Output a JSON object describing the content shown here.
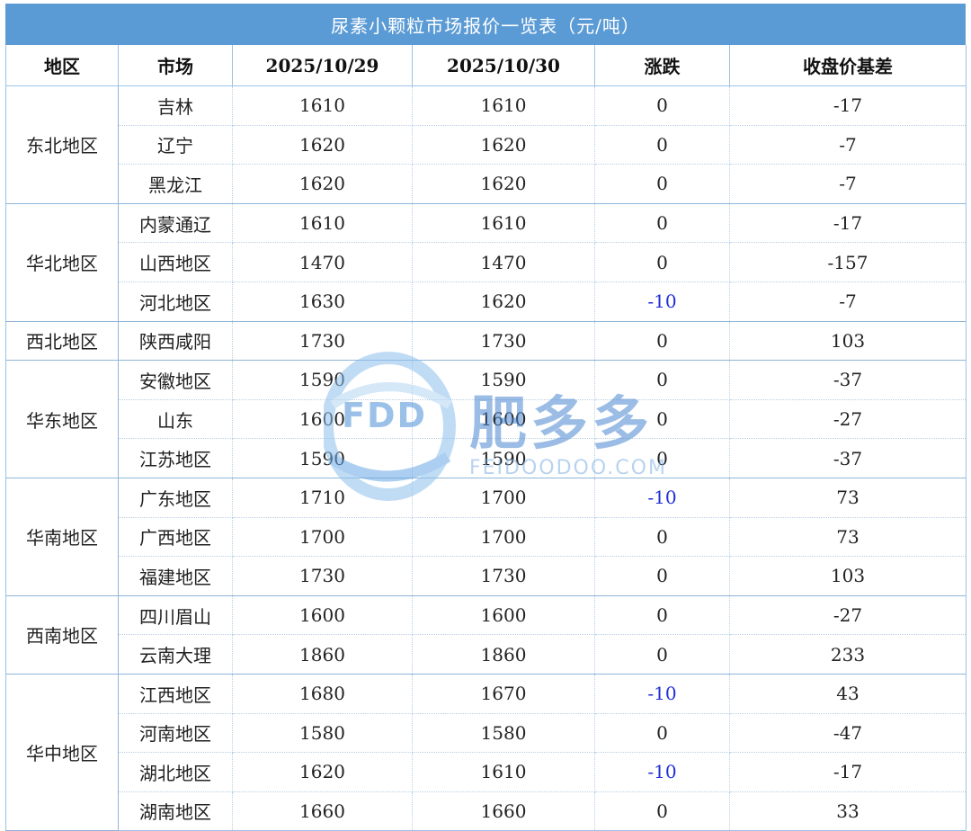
{
  "title": "尿素小颗粒市场报价一览表（元/吨）",
  "headers": [
    "地区",
    "市场",
    "2025/10/29",
    "2025/10/30",
    "涨跌",
    "收盘价基差"
  ],
  "groups": [
    {
      "region": "东北地区",
      "rows": [
        {
          "market": "吉林",
          "d1": "1610",
          "d2": "1610",
          "change": "0",
          "basis": "-17"
        },
        {
          "market": "辽宁",
          "d1": "1620",
          "d2": "1620",
          "change": "0",
          "basis": "-7"
        },
        {
          "market": "黑龙江",
          "d1": "1620",
          "d2": "1620",
          "change": "0",
          "basis": "-7"
        }
      ]
    },
    {
      "region": "华北地区",
      "rows": [
        {
          "market": "内蒙通辽",
          "d1": "1610",
          "d2": "1610",
          "change": "0",
          "basis": "-17"
        },
        {
          "market": "山西地区",
          "d1": "1470",
          "d2": "1470",
          "change": "0",
          "basis": "-157"
        },
        {
          "market": "河北地区",
          "d1": "1630",
          "d2": "1620",
          "change": "-10",
          "basis": "-7"
        }
      ]
    },
    {
      "region": "西北地区",
      "rows": [
        {
          "market": "陕西咸阳",
          "d1": "1730",
          "d2": "1730",
          "change": "0",
          "basis": "103"
        }
      ]
    },
    {
      "region": "华东地区",
      "rows": [
        {
          "market": "安徽地区",
          "d1": "1590",
          "d2": "1590",
          "change": "0",
          "basis": "-37"
        },
        {
          "market": "山东",
          "d1": "1600",
          "d2": "1600",
          "change": "0",
          "basis": "-27"
        },
        {
          "market": "江苏地区",
          "d1": "1590",
          "d2": "1590",
          "change": "0",
          "basis": "-37"
        }
      ]
    },
    {
      "region": "华南地区",
      "rows": [
        {
          "market": "广东地区",
          "d1": "1710",
          "d2": "1700",
          "change": "-10",
          "basis": "73"
        },
        {
          "market": "广西地区",
          "d1": "1700",
          "d2": "1700",
          "change": "0",
          "basis": "73"
        },
        {
          "market": "福建地区",
          "d1": "1730",
          "d2": "1730",
          "change": "0",
          "basis": "103"
        }
      ]
    },
    {
      "region": "西南地区",
      "rows": [
        {
          "market": "四川眉山",
          "d1": "1600",
          "d2": "1600",
          "change": "0",
          "basis": "-27"
        },
        {
          "market": "云南大理",
          "d1": "1860",
          "d2": "1860",
          "change": "0",
          "basis": "233"
        }
      ]
    },
    {
      "region": "华中地区",
      "rows": [
        {
          "market": "江西地区",
          "d1": "1680",
          "d2": "1670",
          "change": "-10",
          "basis": "43"
        },
        {
          "market": "河南地区",
          "d1": "1580",
          "d2": "1580",
          "change": "0",
          "basis": "-47"
        },
        {
          "market": "湖北地区",
          "d1": "1620",
          "d2": "1610",
          "change": "-10",
          "basis": "-17"
        },
        {
          "market": "湖南地区",
          "d1": "1660",
          "d2": "1660",
          "change": "0",
          "basis": "33"
        }
      ]
    }
  ],
  "watermark": {
    "logo_text": "FDD",
    "brand": "肥多多",
    "url": "FEIDOODOO.COM"
  },
  "colors": {
    "title_bg": "#5b9bd5",
    "negative_change": "#1f2fd6",
    "grid": "#9dc3e6"
  }
}
